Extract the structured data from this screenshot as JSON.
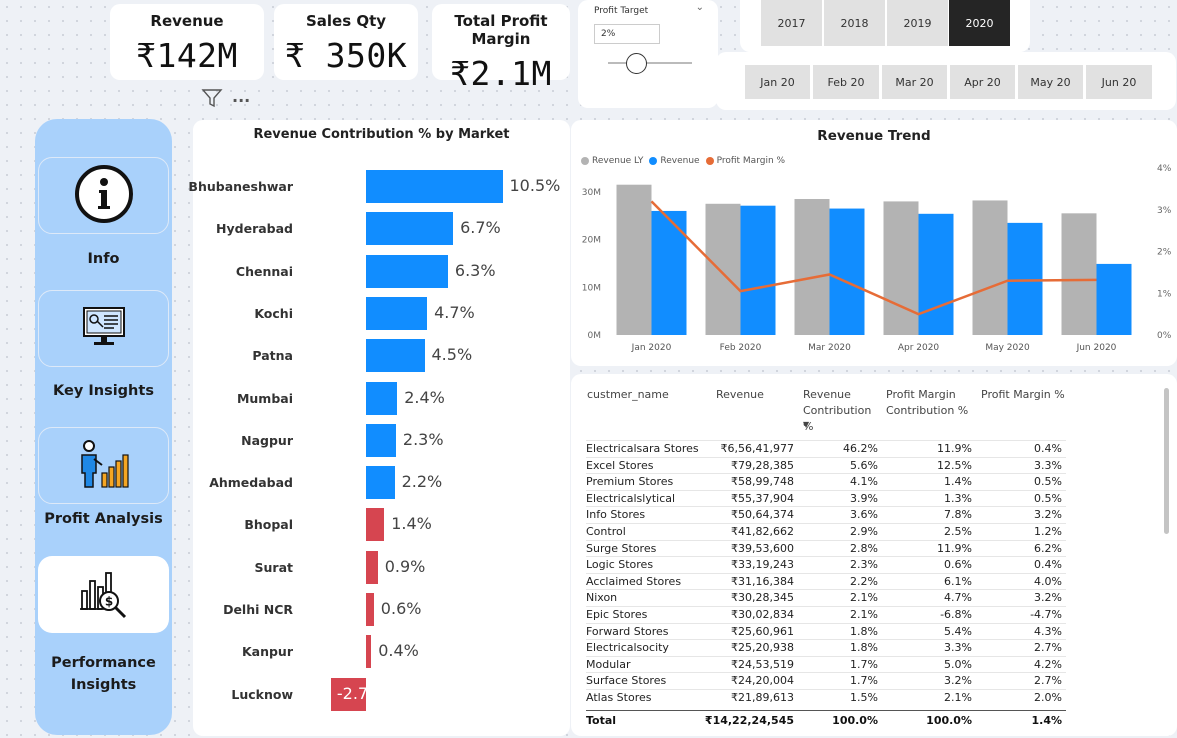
{
  "kpis": {
    "revenue": {
      "title": "Revenue",
      "value": "₹142M"
    },
    "sales_qty": {
      "title": "Sales Qty",
      "value": "₹ 350K"
    },
    "profit_margin": {
      "title": "Total Profit Margin",
      "value": "₹2.1M"
    }
  },
  "profit_target": {
    "label": "Profit Target",
    "value": "2%",
    "chevron": "⌄"
  },
  "years": [
    "2017",
    "2018",
    "2019",
    "2020"
  ],
  "active_year": "2020",
  "months": [
    "Jan 20",
    "Feb 20",
    "Mar 20",
    "Apr 20",
    "May 20",
    "Jun 20"
  ],
  "toolbar": {
    "more": "···"
  },
  "nav": [
    {
      "label": "Info",
      "icon": "info-icon"
    },
    {
      "label": "Key Insights",
      "icon": "monitor-key-icon"
    },
    {
      "label": "Profit Analysis",
      "icon": "presenter-chart-icon"
    },
    {
      "label": "Performance Insights",
      "icon": "chart-magnifier-icon"
    }
  ],
  "colors": {
    "positive_bar": "#118dff",
    "negative_bar": "#d64550",
    "revenue_ly": "#b3b3b3",
    "revenue": "#118dff",
    "profit_margin_line": "#e66c37",
    "sidebar": "#a9d1fb",
    "active_year": "#252525"
  },
  "chart_data": [
    {
      "type": "bar",
      "title": "Revenue Contribution % by Market",
      "categories": [
        "Bhubaneshwar",
        "Hyderabad",
        "Chennai",
        "Kochi",
        "Patna",
        "Mumbai",
        "Nagpur",
        "Ahmedabad",
        "Bhopal",
        "Surat",
        "Delhi NCR",
        "Kanpur",
        "Lucknow"
      ],
      "values": [
        10.5,
        6.7,
        6.3,
        4.7,
        4.5,
        2.4,
        2.3,
        2.2,
        1.4,
        0.9,
        0.6,
        0.4,
        -2.7
      ],
      "labels": [
        "10.5%",
        "6.7%",
        "6.3%",
        "4.7%",
        "4.5%",
        "2.4%",
        "2.3%",
        "2.2%",
        "1.4%",
        "0.9%",
        "0.6%",
        "0.4%",
        "-2.7"
      ]
    },
    {
      "type": "bar",
      "title": "Revenue Trend",
      "categories": [
        "Jan 2020",
        "Feb 2020",
        "Mar 2020",
        "Apr 2020",
        "May 2020",
        "Jun 2020"
      ],
      "series": [
        {
          "name": "Revenue LY",
          "values": [
            31.5,
            27.5,
            28.5,
            28,
            28.2,
            25.5
          ]
        },
        {
          "name": "Revenue",
          "values": [
            26,
            27.1,
            26.5,
            25.4,
            23.5,
            14.9
          ]
        },
        {
          "name": "Profit Margin %",
          "values": [
            3.2,
            1.05,
            1.45,
            0.5,
            1.3,
            1.32
          ]
        }
      ],
      "y_ticks": [
        "0M",
        "10M",
        "20M",
        "30M"
      ],
      "y2_ticks": [
        "0%",
        "1%",
        "2%",
        "3%",
        "4%"
      ],
      "ylim": [
        0,
        35
      ],
      "y2lim": [
        0,
        4
      ]
    }
  ],
  "table": {
    "headers": [
      "custmer_name",
      "Revenue",
      "Revenue Contribution %",
      "Profit Margin Contribution %",
      "Profit Margin %"
    ],
    "sort_indicator": "▼",
    "rows": [
      [
        "Electricalsara Stores",
        "₹6,56,41,977",
        "46.2%",
        "11.9%",
        "0.4%"
      ],
      [
        "Excel Stores",
        "₹79,28,385",
        "5.6%",
        "12.5%",
        "3.3%"
      ],
      [
        "Premium Stores",
        "₹58,99,748",
        "4.1%",
        "1.4%",
        "0.5%"
      ],
      [
        "Electricalslytical",
        "₹55,37,904",
        "3.9%",
        "1.3%",
        "0.5%"
      ],
      [
        "Info Stores",
        "₹50,64,374",
        "3.6%",
        "7.8%",
        "3.2%"
      ],
      [
        "Control",
        "₹41,82,662",
        "2.9%",
        "2.5%",
        "1.2%"
      ],
      [
        "Surge Stores",
        "₹39,53,600",
        "2.8%",
        "11.9%",
        "6.2%"
      ],
      [
        "Logic Stores",
        "₹33,19,243",
        "2.3%",
        "0.6%",
        "0.4%"
      ],
      [
        "Acclaimed Stores",
        "₹31,16,384",
        "2.2%",
        "6.1%",
        "4.0%"
      ],
      [
        "Nixon",
        "₹30,28,345",
        "2.1%",
        "4.7%",
        "3.2%"
      ],
      [
        "Epic Stores",
        "₹30,02,834",
        "2.1%",
        "-6.8%",
        "-4.7%"
      ],
      [
        "Forward Stores",
        "₹25,60,961",
        "1.8%",
        "5.4%",
        "4.3%"
      ],
      [
        "Electricalsocity",
        "₹25,20,938",
        "1.8%",
        "3.3%",
        "2.7%"
      ],
      [
        "Modular",
        "₹24,53,519",
        "1.7%",
        "5.0%",
        "4.2%"
      ],
      [
        "Surface Stores",
        "₹24,20,004",
        "1.7%",
        "3.2%",
        "2.7%"
      ],
      [
        "Atlas Stores",
        "₹21,89,613",
        "1.5%",
        "2.1%",
        "2.0%"
      ]
    ],
    "total": [
      "Total",
      "₹14,22,24,545",
      "100.0%",
      "100.0%",
      "1.4%"
    ]
  }
}
